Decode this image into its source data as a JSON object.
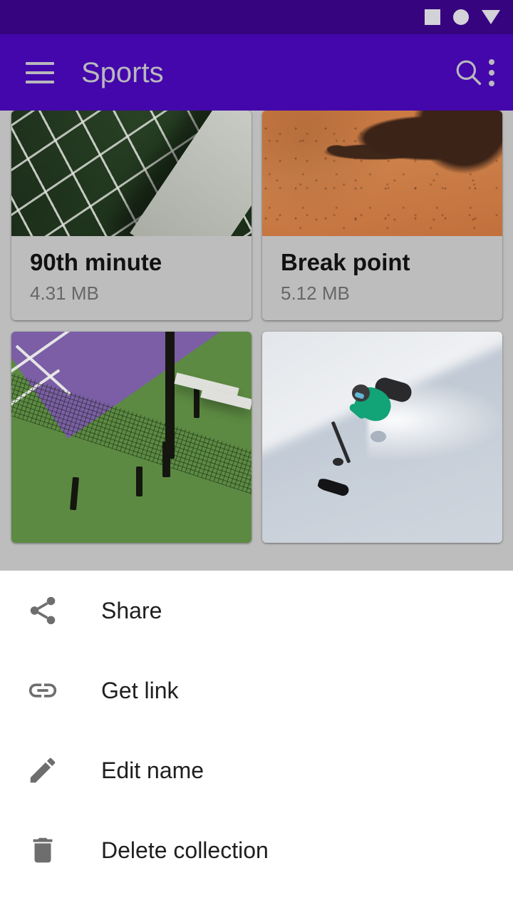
{
  "status_bar": {
    "icons": [
      {
        "name": "square-icon",
        "glyph": "square"
      },
      {
        "name": "circle-icon",
        "glyph": "circle"
      },
      {
        "name": "triangle-down-icon",
        "glyph": "triangle-down"
      }
    ],
    "background_color": "#37047f"
  },
  "app_bar": {
    "title": "Sports",
    "nav_icon": "hamburger-menu-icon",
    "actions": [
      {
        "name": "search-icon",
        "label": "Search"
      },
      {
        "name": "overflow-menu-icon",
        "label": "More options"
      }
    ],
    "background_color": "#4407ab",
    "foreground_color": "#b9b8bd"
  },
  "collection_grid": {
    "background_color": "#bdbdbd",
    "cards": [
      {
        "title": "90th minute",
        "size": "4.31 MB",
        "thumb": "soccer-goal-net-photo"
      },
      {
        "title": "Break point",
        "size": "5.12 MB",
        "thumb": "clay-court-shadow-photo"
      },
      {
        "title": "",
        "size": "",
        "thumb": "tennis-court-aerial-photo"
      },
      {
        "title": "",
        "size": "",
        "thumb": "skier-powder-snow-photo"
      }
    ]
  },
  "bottom_sheet": {
    "background_color": "#ffffff",
    "items": [
      {
        "label": "Share",
        "icon": "share-icon"
      },
      {
        "label": "Get link",
        "icon": "link-icon"
      },
      {
        "label": "Edit name",
        "icon": "pencil-edit-icon"
      },
      {
        "label": "Delete collection",
        "icon": "trash-delete-icon"
      }
    ]
  }
}
